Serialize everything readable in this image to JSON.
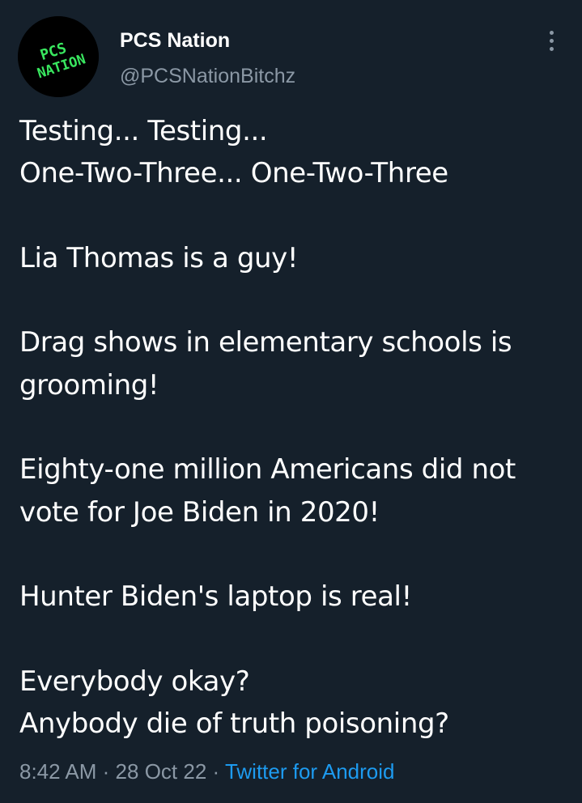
{
  "tweet": {
    "author": {
      "display_name": "PCS Nation",
      "handle": "@PCSNationBitchz",
      "avatar_text": [
        "PCS",
        "NATION"
      ],
      "avatar_text_color": "#39e75f",
      "avatar_bg": "#000000"
    },
    "more_icon": "more-vertical-icon",
    "lines": [
      "Testing... Testing...",
      "One-Two-Three... One-Two-Three",
      "",
      "Lia Thomas is a guy!",
      "",
      "Drag shows in elementary schools is",
      "grooming!",
      "",
      "Eighty-one million Americans did not",
      "vote for Joe Biden in 2020!",
      "",
      "Hunter Biden's laptop is real!",
      "",
      "Everybody okay?",
      "Anybody die of truth poisoning?"
    ],
    "time": "8:42 AM",
    "separator": "·",
    "date": "28 Oct 22",
    "source": "Twitter for Android"
  },
  "colors": {
    "background": "#15202b",
    "text": "#ffffff",
    "secondary": "#8b98a5",
    "link": "#1d9bf0"
  }
}
